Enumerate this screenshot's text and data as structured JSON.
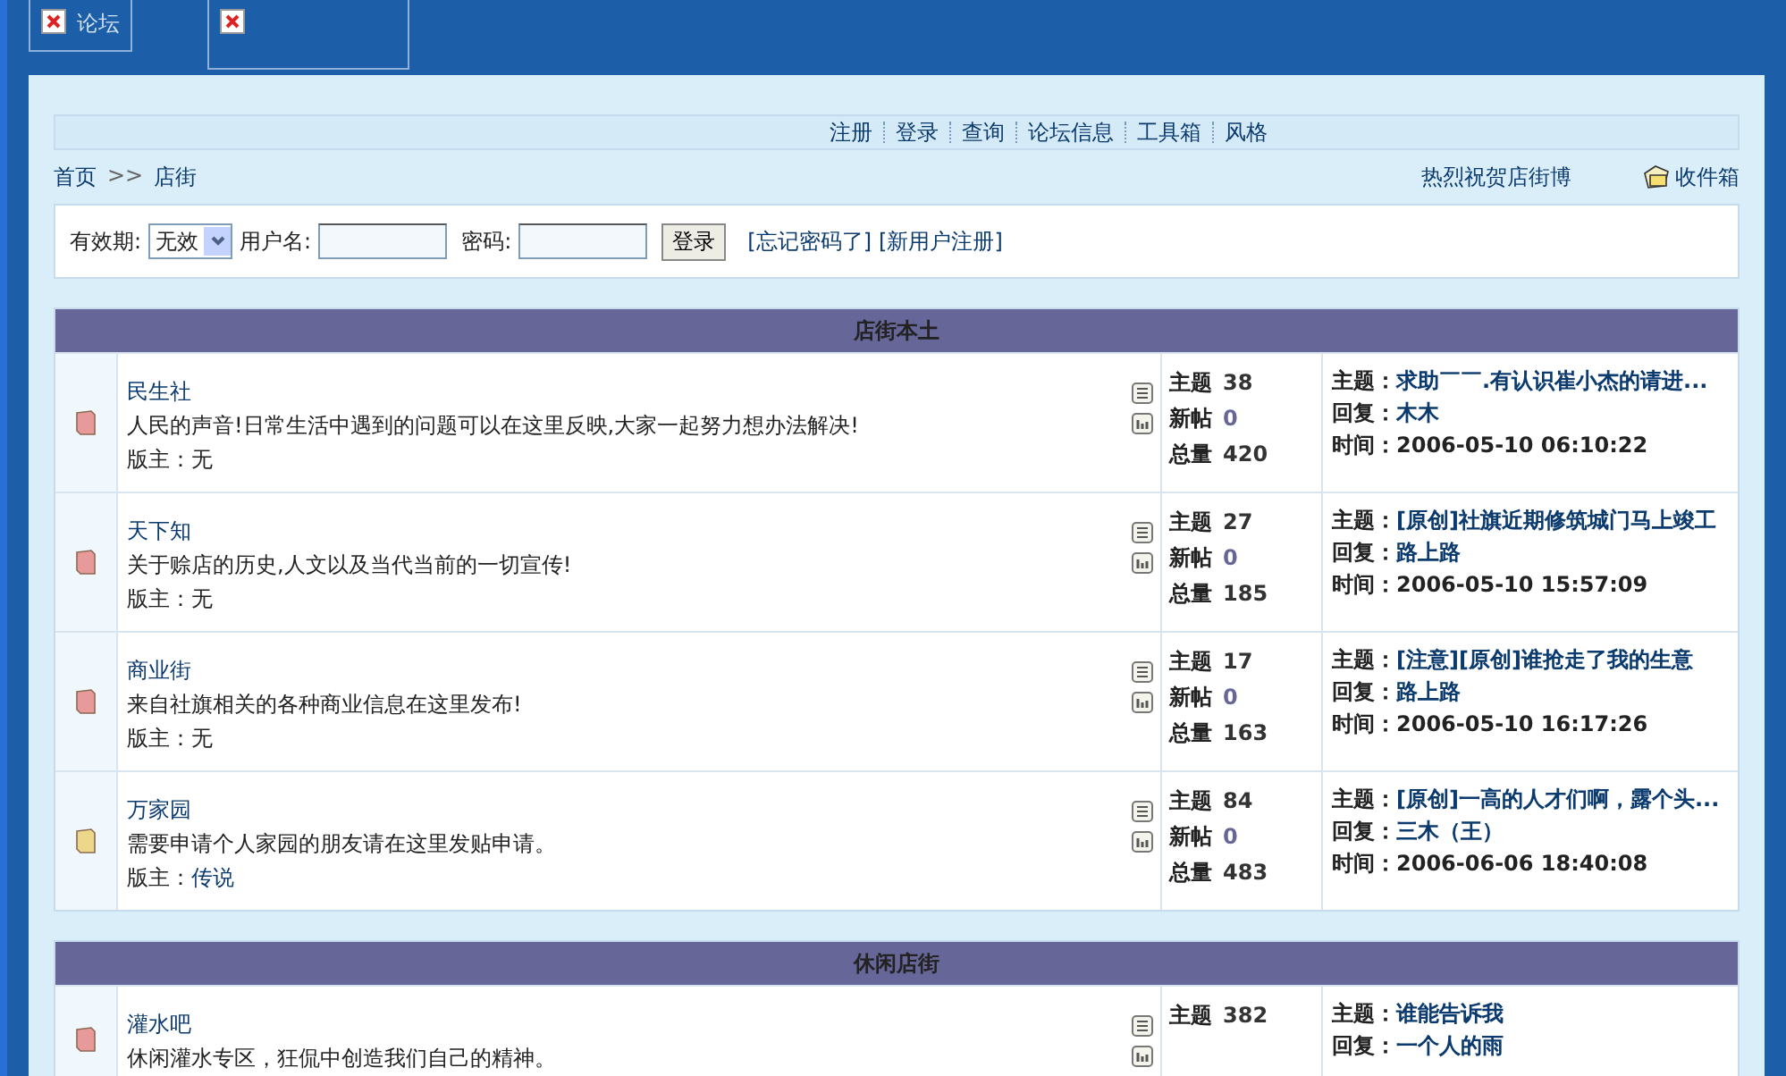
{
  "tabs": [
    {
      "label": "论坛",
      "selected": false
    },
    {
      "selected": true
    }
  ],
  "nav": [
    "注册",
    "登录",
    "查询",
    "论坛信息",
    "工具箱",
    "风格"
  ],
  "breadcrumb": {
    "home": "首页",
    "separator": ">>",
    "current": "店街"
  },
  "marquee": "热烈祝贺店街博",
  "inbox": "收件箱",
  "login": {
    "expiry_label": "有效期:",
    "expiry_value": "无效",
    "username_label": "用户名:",
    "password_label": "密码:",
    "button": "登录",
    "forgot": "[忘记密码了]",
    "register": "[新用户注册]"
  },
  "sections": [
    {
      "title": "店街本土",
      "forums": [
        {
          "name": "民生社",
          "color": "#e89a9a",
          "description": "人民的声音!日常生活中遇到的问题可以在这里反映,大家一起努力想办法解决!",
          "moderator_label": "版主：",
          "moderator": "无",
          "moderator_link": false,
          "stats": [
            {
              "label": "主题",
              "value": "38"
            },
            {
              "label": "新帖",
              "value": "0"
            },
            {
              "label": "总量",
              "value": "420"
            }
          ],
          "last": {
            "topic_label": "主题：",
            "topic": "求助￣￣.有认识崔小杰的请进...",
            "reply_label": "回复：",
            "reply": "木木",
            "time_label": "时间：",
            "time": "2006-05-10 06:10:22"
          }
        },
        {
          "name": "天下知",
          "color": "#e89a9a",
          "description": "关于赊店的历史,人文以及当代当前的一切宣传!",
          "moderator_label": "版主：",
          "moderator": "无",
          "moderator_link": false,
          "stats": [
            {
              "label": "主题",
              "value": "27"
            },
            {
              "label": "新帖",
              "value": "0"
            },
            {
              "label": "总量",
              "value": "185"
            }
          ],
          "last": {
            "topic_label": "主题：",
            "topic": "[原创]社旗近期修筑城门马上竣工",
            "reply_label": "回复：",
            "reply": "路上路",
            "time_label": "时间：",
            "time": "2006-05-10 15:57:09"
          }
        },
        {
          "name": "商业街",
          "color": "#e89a9a",
          "description": "来自社旗相关的各种商业信息在这里发布!",
          "moderator_label": "版主：",
          "moderator": "无",
          "moderator_link": false,
          "stats": [
            {
              "label": "主题",
              "value": "17"
            },
            {
              "label": "新帖",
              "value": "0"
            },
            {
              "label": "总量",
              "value": "163"
            }
          ],
          "last": {
            "topic_label": "主题：",
            "topic": "[注意][原创]谁抢走了我的生意",
            "reply_label": "回复：",
            "reply": "路上路",
            "time_label": "时间：",
            "time": "2006-05-10 16:17:26"
          }
        },
        {
          "name": "万家园",
          "color": "#ecd88a",
          "description": "需要申请个人家园的朋友请在这里发贴申请。",
          "moderator_label": "版主：",
          "moderator": "传说",
          "moderator_link": true,
          "stats": [
            {
              "label": "主题",
              "value": "84"
            },
            {
              "label": "新帖",
              "value": "0"
            },
            {
              "label": "总量",
              "value": "483"
            }
          ],
          "last": {
            "topic_label": "主题：",
            "topic": "[原创]一高的人才们啊，露个头...",
            "reply_label": "回复：",
            "reply": "三木（王）",
            "time_label": "时间：",
            "time": "2006-06-06 18:40:08"
          }
        }
      ]
    },
    {
      "title": "休闲店街",
      "forums": [
        {
          "name": "灌水吧",
          "color": "#e89a9a",
          "description": "休闲灌水专区，狂侃中创造我们自己的精神。",
          "stats": [
            {
              "label": "主题",
              "value": "382"
            }
          ],
          "last": {
            "topic_label": "主题：",
            "topic": "谁能告诉我",
            "reply_label": "回复：",
            "reply": "一个人的雨"
          }
        }
      ]
    }
  ]
}
